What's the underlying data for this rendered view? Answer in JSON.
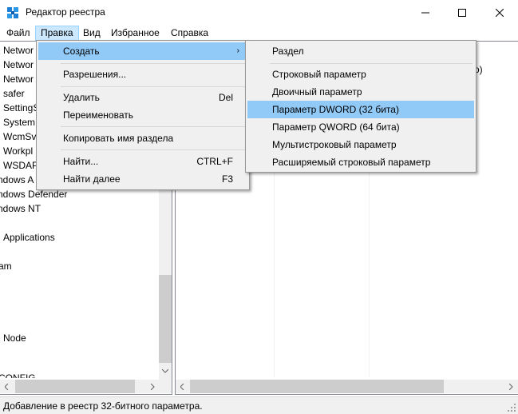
{
  "window": {
    "title": "Редактор реестра",
    "minimize_glyph": "—",
    "maximize_glyph": "☐",
    "close_glyph": "✕"
  },
  "menubar": {
    "items": [
      {
        "label": "Файл"
      },
      {
        "label": "Правка",
        "active": true
      },
      {
        "label": "Вид"
      },
      {
        "label": "Избранное"
      },
      {
        "label": "Справка"
      }
    ]
  },
  "tree": {
    "items": [
      "Networ",
      "Networ",
      "Networ",
      "safer",
      "SettingS",
      "System",
      "WcmSv",
      "Workpl",
      "WSDAP",
      "ndows A",
      "ndows Defender",
      "ndows NT",
      "Applications",
      "am",
      "Node",
      "CONFIG"
    ]
  },
  "list": {
    "fragment": "о)"
  },
  "edit_menu": {
    "items": [
      {
        "label": "Создать",
        "has_submenu": true,
        "highlighted": true
      },
      {
        "label": "Разрешения..."
      },
      {
        "label": "Удалить",
        "shortcut": "Del"
      },
      {
        "label": "Переименовать"
      },
      {
        "label": "Копировать имя раздела"
      },
      {
        "label": "Найти...",
        "shortcut": "CTRL+F"
      },
      {
        "label": "Найти далее",
        "shortcut": "F3"
      }
    ],
    "submenu_arrow": "›"
  },
  "create_submenu": {
    "items": [
      {
        "label": "Раздел"
      },
      {
        "label": "Строковый параметр"
      },
      {
        "label": "Двоичный параметр"
      },
      {
        "label": "Параметр DWORD (32 бита)",
        "highlighted": true
      },
      {
        "label": "Параметр QWORD (64 бита)"
      },
      {
        "label": "Мультистроковый параметр"
      },
      {
        "label": "Расширяемый строковый параметр"
      }
    ]
  },
  "statusbar": {
    "text": "Добавление в реестр 32-битного параметра."
  },
  "colors": {
    "highlight": "#91c9f7",
    "menu_bg": "#f0f0f0",
    "active_menubar": "#cce8ff"
  },
  "icons": {
    "app": "registry-editor-icon",
    "scroll_up": "scroll-up-arrow-icon",
    "scroll_down": "scroll-down-arrow-icon",
    "scroll_left": "scroll-left-arrow-icon",
    "scroll_right": "scroll-right-arrow-icon",
    "grip": "resize-grip-icon"
  }
}
